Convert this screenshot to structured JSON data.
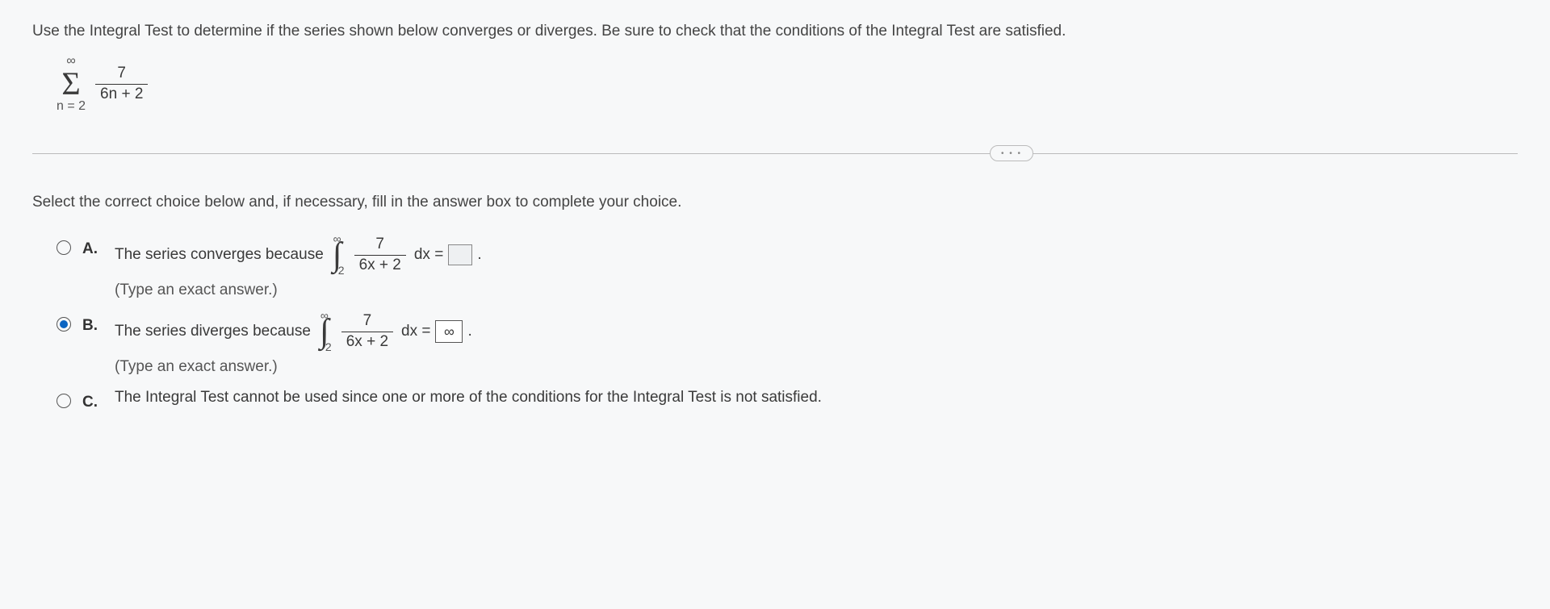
{
  "question": "Use the Integral Test to determine if the series shown below converges or diverges. Be sure to check that the conditions of the Integral Test are satisfied.",
  "series": {
    "upper": "∞",
    "lower": "n = 2",
    "num": "7",
    "den": "6n + 2"
  },
  "divider_button": "• • •",
  "instruction": "Select the correct choice below and, if necessary, fill in the answer box to complete your choice.",
  "choices": {
    "A": {
      "label": "A.",
      "text": "The series converges because",
      "int_upper": "∞",
      "int_lower": "2",
      "frac_num": "7",
      "frac_den": "6x + 2",
      "after": "dx =",
      "answer": "",
      "period": ".",
      "hint": "(Type an exact answer.)",
      "selected": false
    },
    "B": {
      "label": "B.",
      "text": "The series diverges because",
      "int_upper": "∞",
      "int_lower": "2",
      "frac_num": "7",
      "frac_den": "6x + 2",
      "after": "dx =",
      "answer": "∞",
      "period": ".",
      "hint": "(Type an exact answer.)",
      "selected": true
    },
    "C": {
      "label": "C.",
      "text": "The Integral Test cannot be used since one or more of the conditions for the Integral Test is not satisfied.",
      "selected": false
    }
  }
}
